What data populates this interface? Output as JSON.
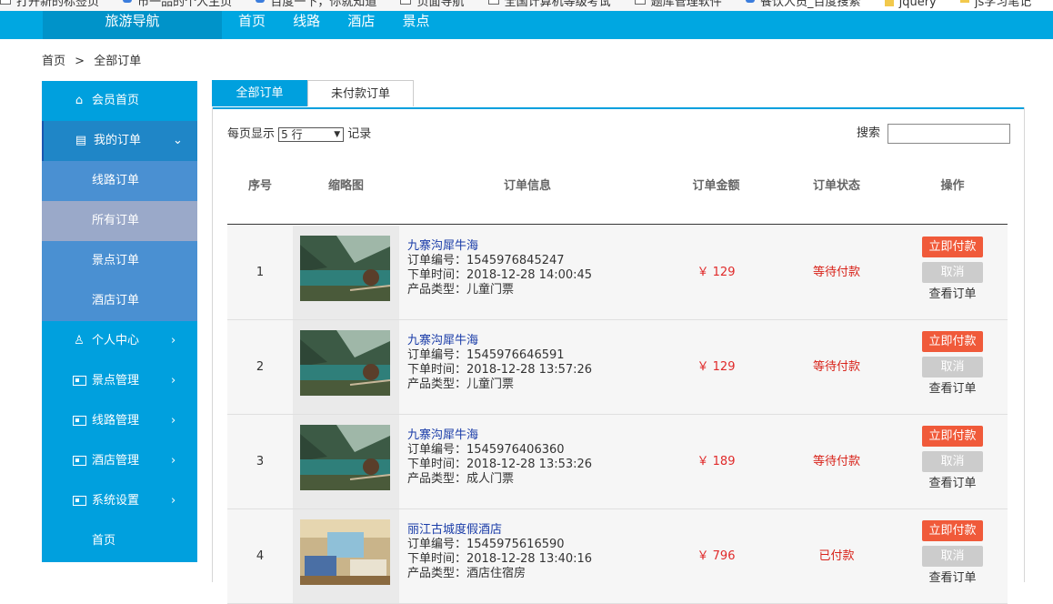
{
  "bookmarks": [
    {
      "icon": "page-icon",
      "label": "打开新的标签页"
    },
    {
      "icon": "baidu-icon",
      "label": "市一品的个人主页"
    },
    {
      "icon": "baidu-icon",
      "label": "百度一下，你就知道"
    },
    {
      "icon": "page-icon",
      "label": "页面导航"
    },
    {
      "icon": "page-icon",
      "label": "全国计算机等级考试"
    },
    {
      "icon": "page-icon",
      "label": "题库管理软件"
    },
    {
      "icon": "baidu-icon",
      "label": "餐饮人员_百度搜索"
    },
    {
      "icon": "folder-icon",
      "label": "jquery"
    },
    {
      "icon": "folder-icon",
      "label": "js学习笔记"
    }
  ],
  "header": {
    "brand": "旅游导航",
    "nav": [
      "首页",
      "线路",
      "酒店",
      "景点"
    ]
  },
  "breadcrumb": {
    "home": "首页",
    "sep": ">",
    "current": "全部订单"
  },
  "sidebar": {
    "items": [
      {
        "label": "会员首页",
        "icon": "home-icon",
        "arrow": ""
      },
      {
        "label": "我的订单",
        "icon": "document-icon",
        "arrow": "⌄"
      },
      {
        "label": "线路订单",
        "icon": "",
        "arrow": ""
      },
      {
        "label": "所有订单",
        "icon": "",
        "arrow": ""
      },
      {
        "label": "景点订单",
        "icon": "",
        "arrow": ""
      },
      {
        "label": "酒店订单",
        "icon": "",
        "arrow": ""
      },
      {
        "label": "个人中心",
        "icon": "user-icon",
        "arrow": "›"
      },
      {
        "label": "景点管理",
        "icon": "card-icon",
        "arrow": "›"
      },
      {
        "label": "线路管理",
        "icon": "card-icon",
        "arrow": "›"
      },
      {
        "label": "酒店管理",
        "icon": "card-icon",
        "arrow": "›"
      },
      {
        "label": "系统设置",
        "icon": "card-icon",
        "arrow": "›"
      },
      {
        "label": "首页",
        "icon": "",
        "arrow": ""
      }
    ]
  },
  "tabs": {
    "all": "全部订单",
    "unpaid": "未付款订单"
  },
  "controls": {
    "per_page_label": "每页显示",
    "per_page_value": "5 行",
    "records_label": "记录",
    "search_label": "搜索",
    "search_value": ""
  },
  "table": {
    "headers": [
      "序号",
      "缩略图",
      "订单信息",
      "订单金额",
      "订单状态",
      "操作"
    ],
    "rows": [
      {
        "index": "1",
        "name": "九寨沟犀牛海",
        "order_no": "订单编号：1545976845247",
        "time": "下单时间：2018-12-28 14:00:45",
        "type": "产品类型：儿童门票",
        "amount": "￥ 129",
        "status": "等待付款",
        "thumb": "lake"
      },
      {
        "index": "2",
        "name": "九寨沟犀牛海",
        "order_no": "订单编号：1545976646591",
        "time": "下单时间：2018-12-28 13:57:26",
        "type": "产品类型：儿童门票",
        "amount": "￥ 129",
        "status": "等待付款",
        "thumb": "lake"
      },
      {
        "index": "3",
        "name": "九寨沟犀牛海",
        "order_no": "订单编号：1545976406360",
        "time": "下单时间：2018-12-28 13:53:26",
        "type": "产品类型：成人门票",
        "amount": "￥ 189",
        "status": "等待付款",
        "thumb": "lake"
      },
      {
        "index": "4",
        "name": "丽江古城度假酒店",
        "order_no": "订单编号：1545975616590",
        "time": "下单时间：2018-12-28 13:40:16",
        "type": "产品类型：酒店住宿房",
        "amount": "￥ 796",
        "status": "已付款",
        "thumb": "hotel"
      }
    ],
    "actions": {
      "pay": "立即付款",
      "cancel": "取消",
      "view": "查看订单"
    }
  },
  "colors": {
    "primary": "#00a7e1",
    "sidebar": "#00a0de",
    "accent_red": "#f05a3a",
    "price_red": "#e02a2a"
  }
}
